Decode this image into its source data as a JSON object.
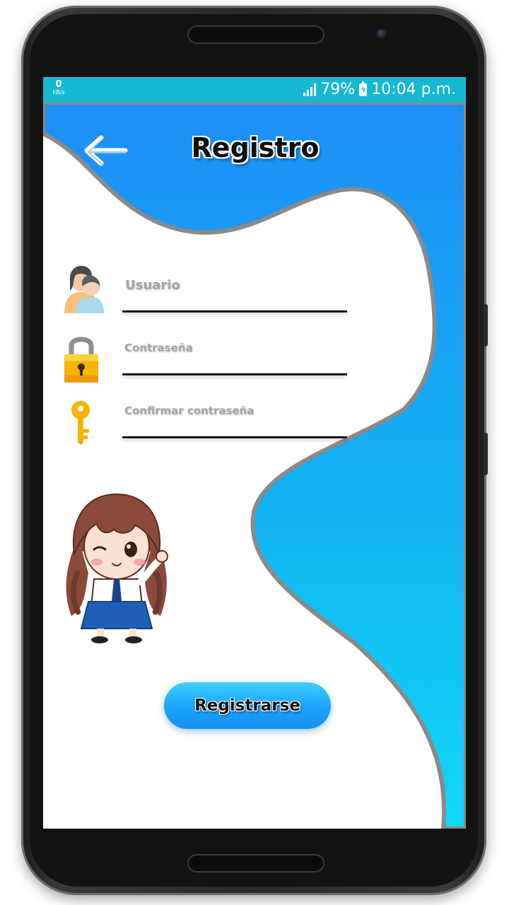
{
  "status_bar": {
    "net_speed_value": "0",
    "net_speed_unit": "KB/s",
    "battery": "79%",
    "time": "10:04 p.m."
  },
  "header": {
    "title": "Registro",
    "back_icon": "arrow-left-icon"
  },
  "form": {
    "usuario_label": "Usuario",
    "contrasena_label": "Contraseña",
    "confirmar_label": "Confirmar contraseña",
    "usuario_icon": "users-icon",
    "contrasena_icon": "padlock-icon",
    "confirmar_icon": "key-icon"
  },
  "illustration": "chibi-girl-winking",
  "register_button_label": "Registrarse",
  "colors": {
    "status_bar": "#17b8d2",
    "wave_top": "#1e8ef6",
    "wave_bottom": "#11d2f6",
    "wave_outline": "#8a8a8a",
    "button": "#1aa2ff"
  }
}
